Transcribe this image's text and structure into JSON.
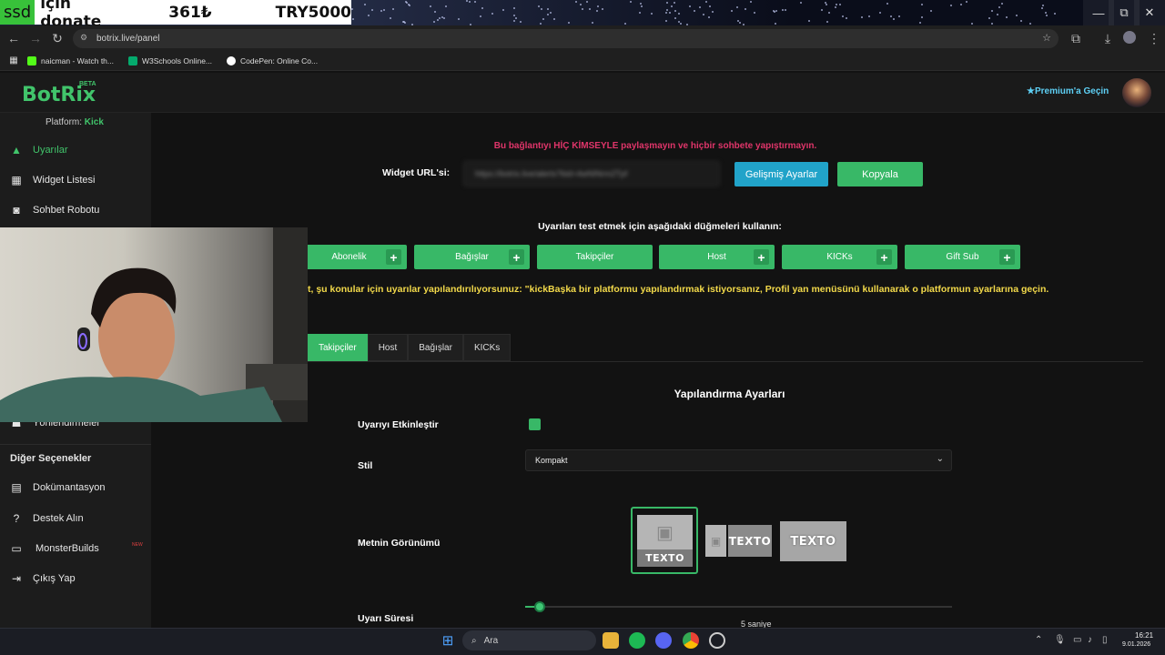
{
  "overlay": {
    "ssd_tag": "ssd",
    "donate_text": "için donate",
    "amount": "361₺",
    "goal": "TRY5000"
  },
  "window_controls": {
    "minimize": "—",
    "restore": "⧉",
    "close": "✕"
  },
  "browser": {
    "url": "botrix.live/panel",
    "bookmarks": [
      "naicman - Watch th...",
      "W3Schools Online...",
      "CodePen: Online Co..."
    ]
  },
  "header": {
    "logo": "BotRix",
    "beta": "BETA",
    "premium": "Premium'a Geçin"
  },
  "sidebar": {
    "platform_label": "Platform:",
    "platform_value": "Kick",
    "items": [
      "Uyarılar",
      "Widget Listesi",
      "Sohbet Robotu",
      "Yönlendirmeler"
    ],
    "other_title": "Diğer Seçenekler",
    "other_items": [
      "Dokümantasyon",
      "Destek Alın",
      "MonsterBuilds",
      "Çıkış Yap"
    ],
    "new_badge": "NEW"
  },
  "main": {
    "warning": "Bu bağlantıyı HİÇ KİMSEYLE paylaşmayın ve hiçbir sohbete yapıştırmayın.",
    "widget_label": "Widget URL'si:",
    "widget_url": "https://botrix.live/alerts?bid=4wNINrm2Tpf",
    "btn_advanced": "Gelişmiş Ayarlar",
    "btn_copy": "Kopyala",
    "test_instructions": "Uyarıları test etmek için aşağıdaki düğmeleri kullanın:",
    "test_buttons": [
      "Abonelik",
      "Bağışlar",
      "Takipçiler",
      "Host",
      "KICKs",
      "Gift Sub"
    ],
    "platform_note": "t, şu konular için uyarılar yapılandırılıyorsunuz: \"kickBaşka bir platformu yapılandırmak istiyorsanız, Profil yan menüsünü kullanarak o platformun ayarlarına geçin.",
    "tabs": [
      "Takipçiler",
      "Host",
      "Bağışlar",
      "KICKs"
    ],
    "active_tab": "Takipçiler",
    "config_title": "Yapılandırma Ayarları",
    "enable_label": "Uyarıyı Etkinleştir",
    "enable_value": true,
    "style_label": "Stil",
    "style_value": "Kompakt",
    "look_label": "Metnin Görünümü",
    "look_sample_text": "TEXTO",
    "duration_label": "Uyarı Süresi",
    "duration_value": "5",
    "duration_unit": "saniye",
    "duration_fraction": 0.035
  },
  "taskbar": {
    "search_placeholder": "Ara",
    "time": "16:21",
    "date": "9.01.2026"
  },
  "colors": {
    "accent": "#38b867",
    "info": "#21a3c9",
    "warning": "#e0356a",
    "note": "#f2d94a",
    "premium": "#5ed0f5"
  }
}
